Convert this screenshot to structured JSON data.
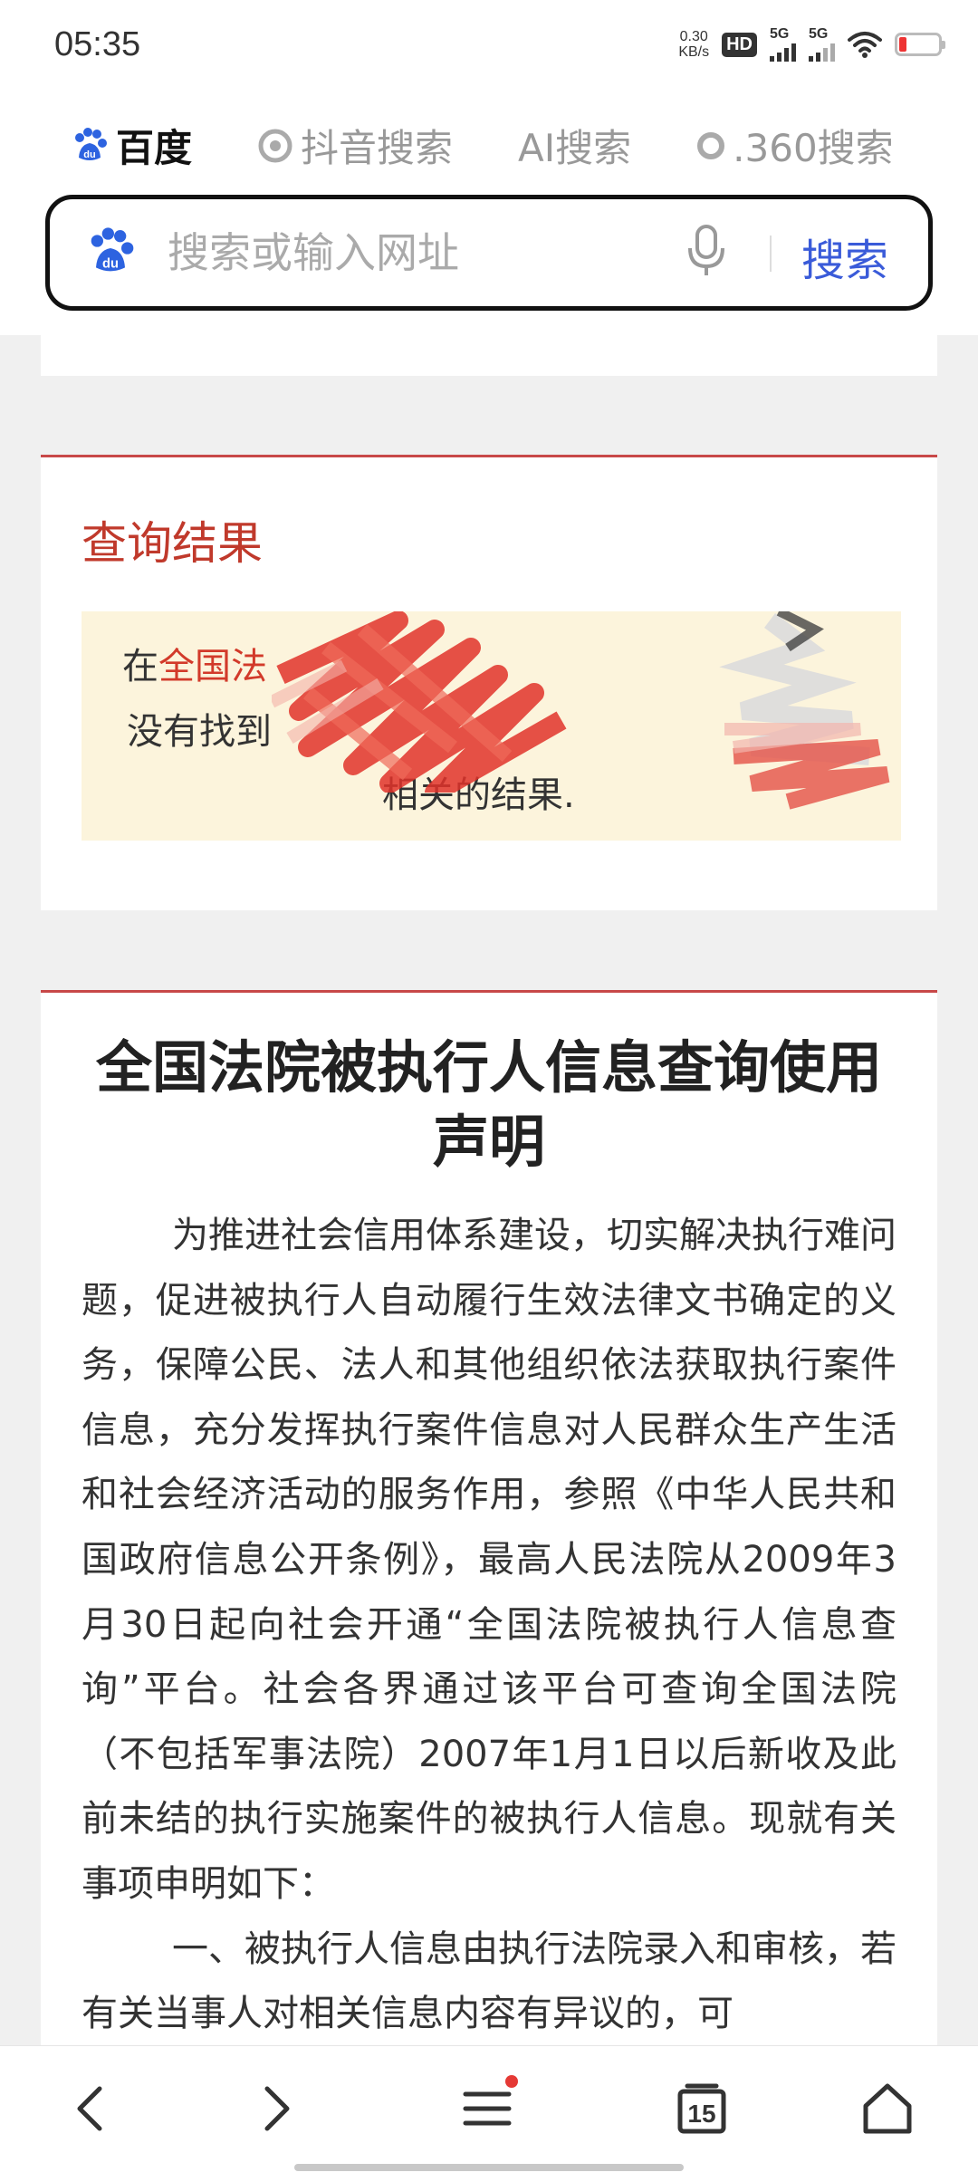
{
  "status_bar": {
    "time": "05:35",
    "net_speed_value": "0.30",
    "net_speed_unit": "KB/s",
    "hd_label": "HD",
    "signal_1": "5G",
    "signal_2": "5G",
    "battery_color": "#e33333"
  },
  "engines": [
    {
      "label": "百度",
      "icon": "baidu-paw-icon",
      "active": true
    },
    {
      "label": "抖音搜索",
      "icon": "douyin-icon",
      "active": false
    },
    {
      "label": "AI搜索",
      "icon": "ai-icon",
      "active": false
    },
    {
      "label": ".360搜索",
      "icon": "360-icon",
      "active": false
    }
  ],
  "search": {
    "placeholder": "搜索或输入网址",
    "button_label": "搜索",
    "accent_color": "#3a5bd9"
  },
  "result": {
    "title": "查询结果",
    "line1_prefix": "在",
    "line1_highlight": "全国法",
    "line2": "没有找到",
    "line3": "相关的结果."
  },
  "statement": {
    "title": "全国法院被执行人信息查询使用声明",
    "para1": "为推进社会信用体系建设，切实解决执行难问题，促进被执行人自动履行生效法律文书确定的义务，保障公民、法人和其他组织依法获取执行案件信息，充分发挥执行案件信息对人民群众生产生活和社会经济活动的服务作用，参照《中华人民共和国政府信息公开条例》，最高人民法院从2009年3月30日起向社会开通“全国法院被执行人信息查询”平台。社会各界通过该平台可查询全国法院（不包括军事法院）2007年1月1日以后新收及此前未结的执行实施案件的被执行人信息。现就有关事项申明如下：",
    "para2": "一、被执行人信息由执行法院录入和审核，若有关当事人对相关信息内容有异议的，可"
  },
  "bottom_nav": {
    "tabs_count": "15",
    "items": [
      "back-icon",
      "forward-icon",
      "menu-icon",
      "tabs-icon",
      "home-icon"
    ]
  },
  "colors": {
    "accent_red": "#c84848",
    "result_bg": "#fcf4dc"
  }
}
